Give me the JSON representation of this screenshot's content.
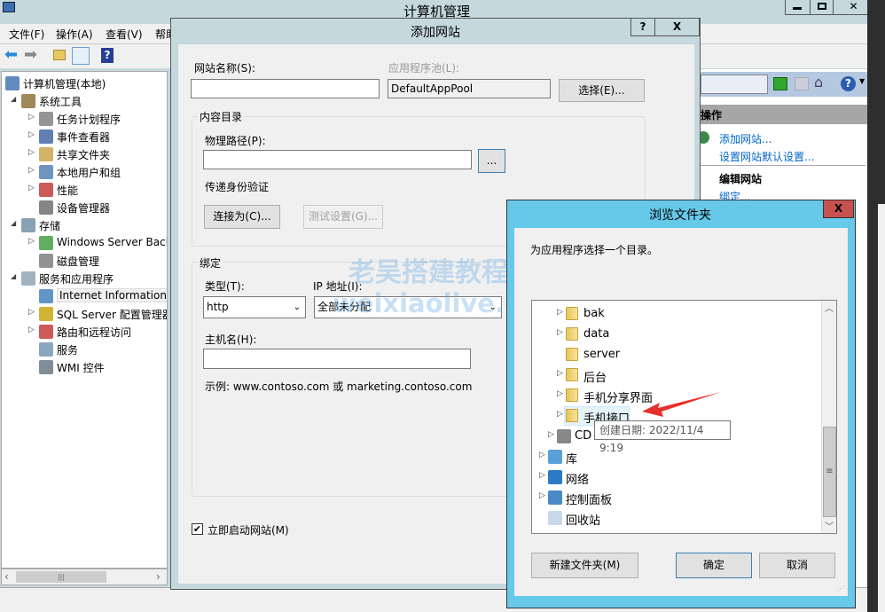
{
  "main_window": {
    "title": "计算机管理",
    "menu": [
      "文件(F)",
      "操作(A)",
      "查看(V)",
      "帮助"
    ],
    "tree": [
      {
        "label": "计算机管理(本地)",
        "level": 0,
        "icon": "computer-icon"
      },
      {
        "label": "系统工具",
        "level": 1,
        "expanded": true,
        "icon": "tools-icon"
      },
      {
        "label": "任务计划程序",
        "level": 2,
        "arrow": true,
        "icon": "clock-icon"
      },
      {
        "label": "事件查看器",
        "level": 2,
        "arrow": true,
        "icon": "event-viewer-icon"
      },
      {
        "label": "共享文件夹",
        "level": 2,
        "arrow": true,
        "icon": "shared-folder-icon"
      },
      {
        "label": "本地用户和组",
        "level": 2,
        "arrow": true,
        "icon": "users-icon"
      },
      {
        "label": "性能",
        "level": 2,
        "arrow": true,
        "icon": "performance-icon"
      },
      {
        "label": "设备管理器",
        "level": 2,
        "arrow": false,
        "icon": "device-manager-icon"
      },
      {
        "label": "存储",
        "level": 1,
        "expanded": true,
        "icon": "storage-icon"
      },
      {
        "label": "Windows Server Back",
        "level": 2,
        "arrow": true,
        "icon": "backup-icon"
      },
      {
        "label": "磁盘管理",
        "level": 2,
        "arrow": false,
        "icon": "disk-icon"
      },
      {
        "label": "服务和应用程序",
        "level": 1,
        "expanded": true,
        "icon": "services-apps-icon"
      },
      {
        "label": "Internet Information S",
        "level": 2,
        "arrow": false,
        "selected": true,
        "icon": "iis-icon"
      },
      {
        "label": "SQL Server 配置管理器",
        "level": 2,
        "arrow": true,
        "icon": "sql-icon"
      },
      {
        "label": "路由和远程访问",
        "level": 2,
        "arrow": true,
        "icon": "routing-icon"
      },
      {
        "label": "服务",
        "level": 2,
        "arrow": false,
        "icon": "gear-icon"
      },
      {
        "label": "WMI 控件",
        "level": 2,
        "arrow": false,
        "icon": "wmi-icon"
      }
    ],
    "actions": {
      "header": "操作",
      "add_site": "添加网站...",
      "site_defaults": "设置网站默认设置...",
      "edit_header": "编辑网站",
      "bindings": "绑定..."
    }
  },
  "add_site_dialog": {
    "title": "添加网站",
    "help": "?",
    "close": "X",
    "site_name_label": "网站名称(S):",
    "site_name_value": "",
    "app_pool_label": "应用程序池(L):",
    "app_pool_value": "DefaultAppPool",
    "select_button": "选择(E)...",
    "content_group": "内容目录",
    "physical_path_label": "物理路径(P):",
    "physical_path_value": "",
    "browse_button": "...",
    "pass_auth_label": "传递身份验证",
    "connect_as_button": "连接为(C)...",
    "test_settings_button": "测试设置(G)...",
    "binding_group": "绑定",
    "type_label": "类型(T):",
    "type_value": "http",
    "ip_label": "IP 地址(I):",
    "ip_value": "全部未分配",
    "host_label": "主机名(H):",
    "host_value": "",
    "example": "示例: www.contoso.com 或 marketing.contoso.com",
    "start_now_label": "立即启动网站(M)",
    "start_now_checked": true
  },
  "browse_dialog": {
    "title": "浏览文件夹",
    "close": "X",
    "prompt": "为应用程序选择一个目录。",
    "items": [
      {
        "label": "bak",
        "level": 2,
        "arrow": true,
        "icon": "folder-icon"
      },
      {
        "label": "data",
        "level": 2,
        "arrow": true,
        "icon": "folder-icon"
      },
      {
        "label": "server",
        "level": 2,
        "arrow": false,
        "icon": "folder-icon"
      },
      {
        "label": "后台",
        "level": 2,
        "arrow": true,
        "icon": "folder-icon"
      },
      {
        "label": "手机分享界面",
        "level": 2,
        "arrow": true,
        "icon": "folder-icon"
      },
      {
        "label": "手机接口",
        "level": 2,
        "arrow": true,
        "icon": "folder-icon",
        "hover": true
      },
      {
        "label": "CD",
        "level": 1,
        "arrow": true,
        "icon": "cd-drive-icon"
      },
      {
        "label": "库",
        "level": 0,
        "arrow": true,
        "icon": "library-icon"
      },
      {
        "label": "网络",
        "level": 0,
        "arrow": true,
        "icon": "network-icon"
      },
      {
        "label": "控制面板",
        "level": 0,
        "arrow": true,
        "icon": "control-panel-icon"
      },
      {
        "label": "回收站",
        "level": 0,
        "arrow": false,
        "icon": "recycle-bin-icon"
      }
    ],
    "tooltip": "创建日期: 2022/11/4 9:19",
    "new_folder_button": "新建文件夹(M)",
    "ok_button": "确定",
    "cancel_button": "取消"
  },
  "watermark": {
    "line1": "老吴搭建教程",
    "line2": "weixiaolive.com"
  },
  "colors": {
    "accent": "#66c9ea",
    "close_red": "#c75050",
    "link": "#0066cc",
    "arrow": "#e8302a"
  }
}
